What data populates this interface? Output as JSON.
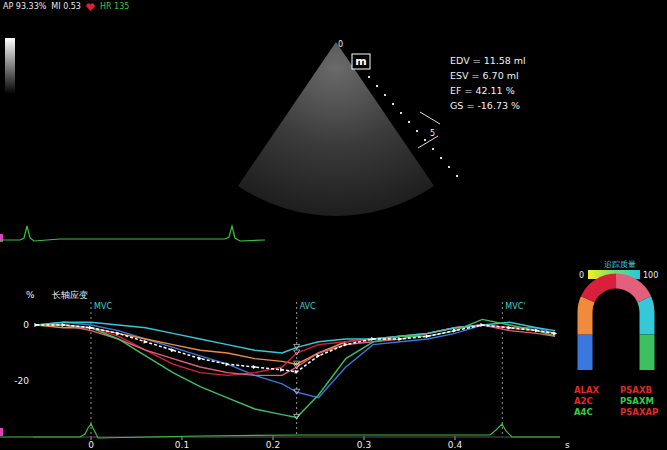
{
  "header": {
    "ap": "AP 93.33%",
    "mi": "MI 0.53",
    "hr": "HR 135"
  },
  "image": {
    "depth_marks": [
      "0",
      "5"
    ],
    "mode_badge": "m"
  },
  "measurements": [
    "EDV = 11.58 ml",
    "ESV = 6.70 ml",
    "EF = 42.11 %",
    "GS = -16.73 %"
  ],
  "chart": {
    "unit": "%",
    "title": "长轴应变",
    "y_ticks": [
      {
        "label": "0",
        "v": 0
      },
      {
        "label": "-20",
        "v": -20
      }
    ],
    "x_ticks": [
      {
        "label": "0",
        "t": 0
      },
      {
        "label": "0.1",
        "t": 0.1
      },
      {
        "label": "0.2",
        "t": 0.2
      },
      {
        "label": "0.3",
        "t": 0.3
      },
      {
        "label": "0.4",
        "t": 0.4
      }
    ],
    "x_unit": "s",
    "events": [
      {
        "label": "MVC",
        "t": 0
      },
      {
        "label": "AVC",
        "t": 0.226
      },
      {
        "label": "MVC'",
        "t": 0.452
      }
    ],
    "times": [
      -0.06,
      -0.03,
      0,
      0.03,
      0.06,
      0.09,
      0.12,
      0.15,
      0.18,
      0.21,
      0.226,
      0.25,
      0.28,
      0.31,
      0.34,
      0.37,
      0.4,
      0.43,
      0.46,
      0.49,
      0.51
    ],
    "series": [
      {
        "color": "#3a78e0",
        "values": [
          0,
          1,
          0,
          -2,
          -5,
          -8,
          -11,
          -14,
          -18,
          -21,
          -24,
          -26,
          -15,
          -7,
          -6,
          -5,
          -3,
          0,
          -1,
          -1,
          -3
        ]
      },
      {
        "color": "#f08a3c",
        "values": [
          0,
          -1,
          -1,
          -3,
          -5,
          -7,
          -9,
          -10,
          -12,
          -13,
          -14,
          -10,
          -6,
          -5,
          -4,
          -3,
          -1,
          0,
          -1,
          -2,
          -3
        ]
      },
      {
        "color": "#d8203a",
        "values": [
          0,
          0,
          -1,
          -4,
          -9,
          -14,
          -17,
          -18,
          -17,
          -15,
          -10,
          -7,
          -6,
          -5,
          -4,
          -3,
          -1,
          0,
          -1,
          -2,
          -4
        ]
      },
      {
        "color": "#e2607c",
        "values": [
          0,
          0,
          -2,
          -5,
          -9,
          -12,
          -15,
          -17,
          -18,
          -18,
          -15,
          -10,
          -7,
          -6,
          -5,
          -3,
          -1,
          0,
          -2,
          -3,
          -4
        ]
      },
      {
        "color": "#35c8d8",
        "values": [
          0,
          1,
          1,
          0,
          -1,
          -3,
          -5,
          -7,
          -9,
          -10,
          -8,
          -6,
          -5,
          -5,
          -4,
          -3,
          -1,
          0,
          1,
          -1,
          -2
        ]
      },
      {
        "color": "#3cc060",
        "values": [
          0,
          0,
          -1,
          -5,
          -11,
          -17,
          -22,
          -26,
          -30,
          -32,
          -33,
          -25,
          -12,
          -6,
          -4,
          -4,
          -2,
          2,
          0,
          -2,
          -4
        ]
      }
    ],
    "average": {
      "values": [
        0,
        0,
        -1,
        -3,
        -6,
        -9,
        -12,
        -14,
        -15,
        -16,
        -16.7,
        -11,
        -7,
        -5,
        -5,
        -4,
        -2,
        0,
        -1,
        -2,
        -3
      ]
    }
  },
  "quality_scale": {
    "title": "追踪质量",
    "min": "0",
    "max": "100"
  },
  "legend": [
    {
      "label": "ALAX",
      "color": "#e02828"
    },
    {
      "label": "A2C",
      "color": "#e02828"
    },
    {
      "label": "A4C",
      "color": "#30d040"
    },
    {
      "label": "PSAXB",
      "color": "#e02828"
    },
    {
      "label": "PSAXM",
      "color": "#30d040"
    },
    {
      "label": "PSAXAP",
      "color": "#e02828"
    }
  ]
}
